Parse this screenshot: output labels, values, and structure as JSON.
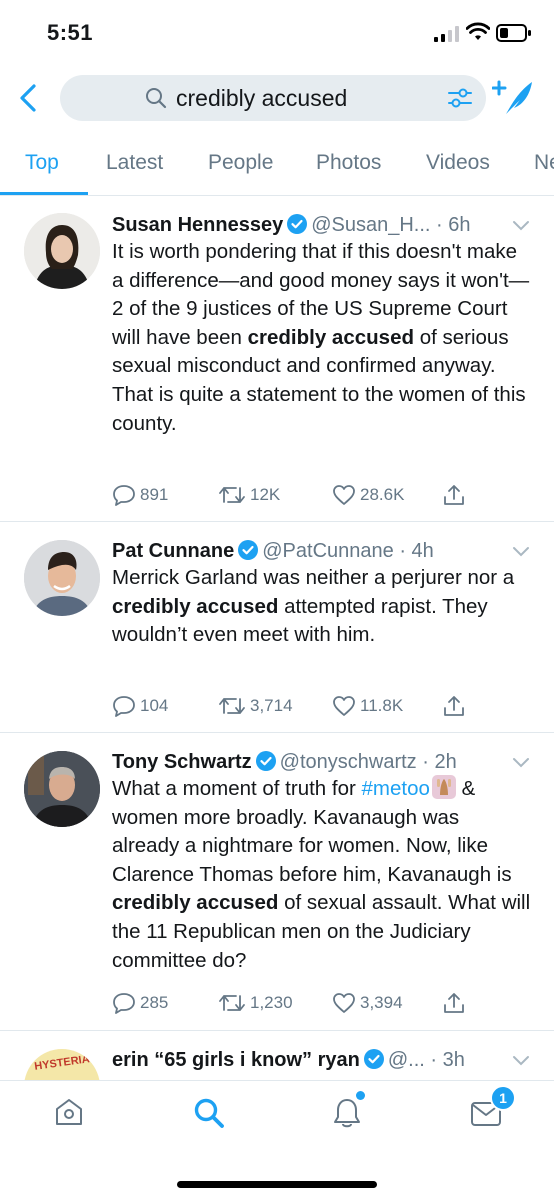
{
  "status_bar": {
    "time": "5:51"
  },
  "search": {
    "query": "credibly accused"
  },
  "tabs": [
    {
      "label": "Top"
    },
    {
      "label": "Latest"
    },
    {
      "label": "People"
    },
    {
      "label": "Photos"
    },
    {
      "label": "Videos"
    },
    {
      "label": "Ne"
    }
  ],
  "tweets": [
    {
      "name": "Susan Hennessey",
      "handle": "@Susan_H...",
      "time": "6h",
      "text_before": "It is worth pondering that if this doesn't make a difference—and good money says it won't—2 of the 9 justices of the US Supreme Court will have been ",
      "highlight": "credibly accused",
      "text_after": " of serious sexual misconduct and confirmed anyway. That is quite a statement to the women of this county.",
      "replies": "891",
      "retweets": "12K",
      "likes": "28.6K"
    },
    {
      "name": "Pat Cunnane",
      "handle": "@PatCunnane",
      "time": "4h",
      "text_before": "Merrick Garland was neither a perjurer nor a ",
      "highlight": "credibly accused",
      "text_after": " attempted rapist. They wouldn’t even meet with him.",
      "replies": "104",
      "retweets": "3,714",
      "likes": "11.8K"
    },
    {
      "name": "Tony Schwartz",
      "handle": "@tonyschwartz",
      "time": "2h",
      "text_before": "What a moment of truth for ",
      "hashtag": "#metoo",
      "text_mid": " & women more broadly. Kavanaugh was already a nightmare for women. Now, like Clarence Thomas before him, Kavanaugh is ",
      "highlight": "credibly accused",
      "text_after": " of sexual assault. What will the 11 Republican men on the Judiciary committee do?",
      "replies": "285",
      "retweets": "1,230",
      "likes": "3,394"
    },
    {
      "name": "erin “65 girls i know” ryan",
      "handle": "@...",
      "time": "3h",
      "avatar_text": "HYSTERIA"
    }
  ],
  "bottom_nav": {
    "messages_badge": "1"
  },
  "colors": {
    "accent": "#1da1f2",
    "secondary_text": "#657786",
    "divider": "#e1e8ed"
  }
}
